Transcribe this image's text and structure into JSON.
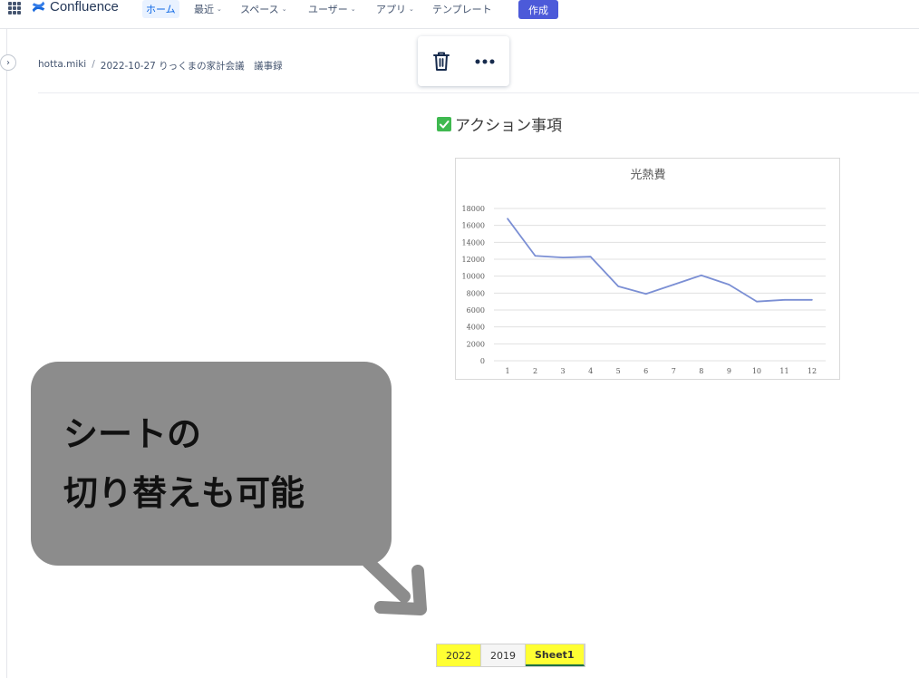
{
  "topnav": {
    "app_name": "Confluence",
    "items": [
      {
        "label": "ホーム",
        "dropdown": false
      },
      {
        "label": "最近",
        "dropdown": true
      },
      {
        "label": "スペース",
        "dropdown": true
      },
      {
        "label": "ユーザー",
        "dropdown": true
      },
      {
        "label": "アプリ",
        "dropdown": true
      },
      {
        "label": "テンプレート",
        "dropdown": false
      }
    ],
    "create_label": "作成",
    "brand_color": "#0052cc",
    "create_color": "#4c5ad9"
  },
  "breadcrumb": {
    "items": [
      "hotta.miki",
      "2022-10-27 りっくまの家計会議　議事録"
    ],
    "separator": "/"
  },
  "toolbar": {
    "delete_icon": "trash-icon",
    "more_icon": "more-horizontal-icon"
  },
  "content": {
    "heading": "アクション事項",
    "heading_icon": "checkbox-checked-icon"
  },
  "chart_data": {
    "type": "line",
    "title": "光熱費",
    "categories": [
      "1",
      "2",
      "3",
      "4",
      "5",
      "6",
      "7",
      "8",
      "9",
      "10",
      "11",
      "12"
    ],
    "values": [
      16800,
      12400,
      12200,
      12300,
      8800,
      7900,
      9000,
      10100,
      9000,
      7000,
      7200,
      7200
    ],
    "yticks": [
      "0",
      "2000",
      "4000",
      "6000",
      "8000",
      "10000",
      "12000",
      "14000",
      "16000",
      "18000"
    ],
    "ylim": [
      0,
      18000
    ],
    "xlabel": "",
    "ylabel": "",
    "grid": true,
    "line_color": "#7b8fd4"
  },
  "callout": {
    "lines": [
      "シートの",
      "切り替えも可能"
    ],
    "color": "#8c8c8c"
  },
  "sheets": {
    "tabs": [
      {
        "label": "2022",
        "highlight": true,
        "active": false
      },
      {
        "label": "2019",
        "highlight": false,
        "active": false
      },
      {
        "label": "Sheet1",
        "highlight": true,
        "active": true
      }
    ],
    "highlight_color": "#ffff33"
  }
}
